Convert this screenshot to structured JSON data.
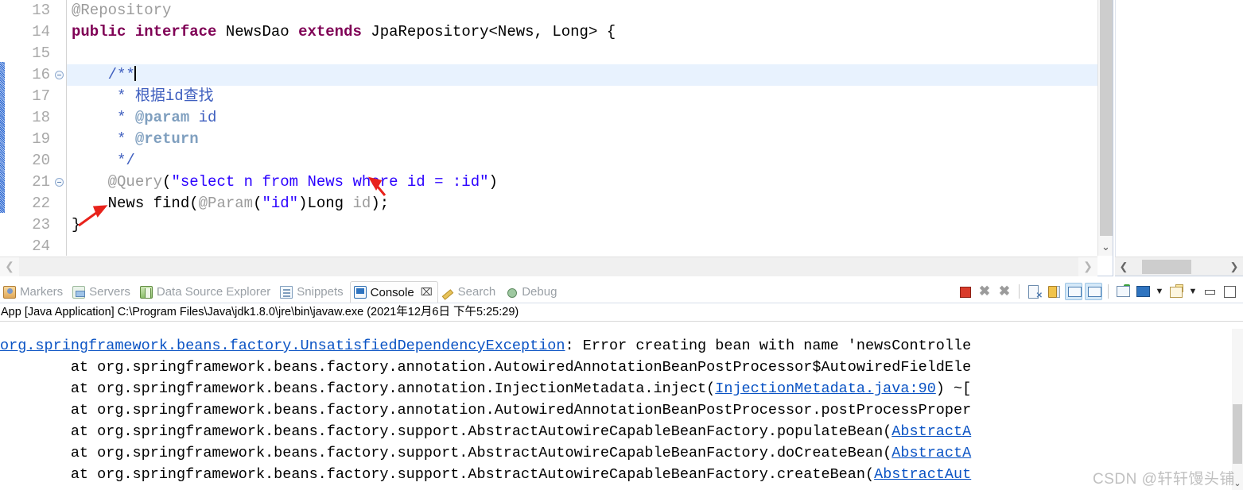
{
  "editor": {
    "lines": [
      {
        "num": "13",
        "fold": false,
        "highlight": false,
        "tokens": [
          {
            "t": "ann",
            "v": "@Repository"
          }
        ]
      },
      {
        "num": "14",
        "fold": false,
        "highlight": false,
        "tokens": [
          {
            "t": "kw",
            "v": "public"
          },
          {
            "t": "plain",
            "v": " "
          },
          {
            "t": "kw",
            "v": "interface"
          },
          {
            "t": "plain",
            "v": " NewsDao "
          },
          {
            "t": "kw",
            "v": "extends"
          },
          {
            "t": "plain",
            "v": " JpaRepository<News, Long> {"
          }
        ]
      },
      {
        "num": "15",
        "fold": false,
        "highlight": false,
        "tokens": []
      },
      {
        "num": "16",
        "fold": true,
        "highlight": true,
        "caret": true,
        "tokens": [
          {
            "t": "plain",
            "v": "    "
          },
          {
            "t": "cmt",
            "v": "/**"
          }
        ]
      },
      {
        "num": "17",
        "fold": false,
        "highlight": false,
        "tokens": [
          {
            "t": "plain",
            "v": "     "
          },
          {
            "t": "cmt",
            "v": "* 根据id查找"
          }
        ]
      },
      {
        "num": "18",
        "fold": false,
        "highlight": false,
        "tokens": [
          {
            "t": "plain",
            "v": "     "
          },
          {
            "t": "cmt",
            "v": "* "
          },
          {
            "t": "cmtk",
            "v": "@param"
          },
          {
            "t": "cmt",
            "v": " id"
          }
        ]
      },
      {
        "num": "19",
        "fold": false,
        "highlight": false,
        "tokens": [
          {
            "t": "plain",
            "v": "     "
          },
          {
            "t": "cmt",
            "v": "* "
          },
          {
            "t": "cmtk",
            "v": "@return"
          }
        ]
      },
      {
        "num": "20",
        "fold": false,
        "highlight": false,
        "tokens": [
          {
            "t": "plain",
            "v": "     "
          },
          {
            "t": "cmt",
            "v": "*/"
          }
        ]
      },
      {
        "num": "21",
        "fold": true,
        "highlight": false,
        "tokens": [
          {
            "t": "plain",
            "v": "    "
          },
          {
            "t": "ann",
            "v": "@Query"
          },
          {
            "t": "plain",
            "v": "("
          },
          {
            "t": "str",
            "v": "\"select n from News where id = :id\""
          },
          {
            "t": "plain",
            "v": ")"
          }
        ]
      },
      {
        "num": "22",
        "fold": false,
        "highlight": false,
        "tokens": [
          {
            "t": "plain",
            "v": "    News find("
          },
          {
            "t": "ann",
            "v": "@Param"
          },
          {
            "t": "plain",
            "v": "("
          },
          {
            "t": "str",
            "v": "\"id\""
          },
          {
            "t": "plain",
            "v": ")Long "
          },
          {
            "t": "ann",
            "v": "id"
          },
          {
            "t": "plain",
            "v": ");"
          }
        ]
      },
      {
        "num": "23",
        "fold": false,
        "highlight": false,
        "tokens": [
          {
            "t": "plain",
            "v": "}"
          }
        ]
      },
      {
        "num": "24",
        "fold": false,
        "highlight": false,
        "tokens": []
      }
    ],
    "scrollbar": {
      "down_arrow": "⌄",
      "left_arrow": "❮",
      "right_arrow": "❯"
    }
  },
  "view_tabs": [
    {
      "label": "Markers",
      "icon": "markers-icon",
      "active": false,
      "closable": false
    },
    {
      "label": "Servers",
      "icon": "servers-icon",
      "active": false,
      "closable": false
    },
    {
      "label": "Data Source Explorer",
      "icon": "data-source-explorer-icon",
      "active": false,
      "closable": false
    },
    {
      "label": "Snippets",
      "icon": "snippets-icon",
      "active": false,
      "closable": false
    },
    {
      "label": "Console",
      "icon": "console-icon",
      "active": true,
      "closable": true,
      "close_glyph": "⌧"
    },
    {
      "label": "Search",
      "icon": "search-icon",
      "active": false,
      "closable": false
    },
    {
      "label": "Debug",
      "icon": "debug-icon",
      "active": false,
      "closable": false
    }
  ],
  "console_toolbar": [
    {
      "name": "terminate-button",
      "kind": "t-stop",
      "selected": false
    },
    {
      "name": "remove-launch-button",
      "kind": "t-x",
      "glyph": "✖",
      "selected": false
    },
    {
      "name": "remove-all-terminated-button",
      "kind": "t-xx",
      "glyph": "✖",
      "selected": false
    },
    {
      "name": "separator-1",
      "kind": "sep"
    },
    {
      "name": "clear-console-button",
      "kind": "t-clear",
      "selected": false
    },
    {
      "name": "scroll-lock-button",
      "kind": "t-lock",
      "selected": false
    },
    {
      "name": "show-console-on-output-button",
      "kind": "t-mon",
      "selected": true
    },
    {
      "name": "show-console-on-error-button",
      "kind": "t-monr",
      "selected": true
    },
    {
      "name": "separator-2",
      "kind": "sep"
    },
    {
      "name": "pin-console-button",
      "kind": "t-pin",
      "selected": false
    },
    {
      "name": "display-selected-console-button",
      "kind": "t-disp",
      "selected": false
    },
    {
      "name": "display-console-dropdown",
      "kind": "t-caret",
      "glyph": "▼"
    },
    {
      "name": "open-console-button",
      "kind": "t-new",
      "selected": false
    },
    {
      "name": "open-console-dropdown",
      "kind": "t-caret",
      "glyph": "▼"
    },
    {
      "name": "minimize-view-button",
      "kind": "t-min"
    },
    {
      "name": "maximize-view-button",
      "kind": "t-max"
    }
  ],
  "console": {
    "header": "App [Java Application] C:\\Program Files\\Java\\jdk1.8.0\\jre\\bin\\javaw.exe (2021年12月6日 下午5:25:29)",
    "lines": [
      {
        "segments": [
          {
            "t": "lnk",
            "v": "org.springframework.beans.factory.UnsatisfiedDependencyException"
          },
          {
            "t": "txt",
            "v": ": Error creating bean with name 'newsControlle"
          }
        ]
      },
      {
        "segments": [
          {
            "t": "txt",
            "v": "        at org.springframework.beans.factory.annotation.AutowiredAnnotationBeanPostProcessor$AutowiredFieldEle"
          }
        ]
      },
      {
        "segments": [
          {
            "t": "txt",
            "v": "        at org.springframework.beans.factory.annotation.InjectionMetadata.inject("
          },
          {
            "t": "lnk",
            "v": "InjectionMetadata.java:90"
          },
          {
            "t": "txt",
            "v": ") ~["
          }
        ]
      },
      {
        "segments": [
          {
            "t": "txt",
            "v": "        at org.springframework.beans.factory.annotation.AutowiredAnnotationBeanPostProcessor.postProcessProper"
          }
        ]
      },
      {
        "segments": [
          {
            "t": "txt",
            "v": "        at org.springframework.beans.factory.support.AbstractAutowireCapableBeanFactory.populateBean("
          },
          {
            "t": "lnk",
            "v": "AbstractA"
          }
        ]
      },
      {
        "segments": [
          {
            "t": "txt",
            "v": "        at org.springframework.beans.factory.support.AbstractAutowireCapableBeanFactory.doCreateBean("
          },
          {
            "t": "lnk",
            "v": "AbstractA"
          }
        ]
      },
      {
        "segments": [
          {
            "t": "txt",
            "v": "        at org.springframework.beans.factory.support.AbstractAutowireCapableBeanFactory.createBean("
          },
          {
            "t": "lnk",
            "v": "AbstractAut"
          }
        ]
      }
    ],
    "scroll_down_glyph": "⌄"
  },
  "watermark": "CSDN @轩轩馒头铺",
  "colors": {
    "keyword": "#7f0055",
    "string": "#2a00ff",
    "comment": "#3f5fbf",
    "comment_tag": "#7f9fbf",
    "annotation": "#9b9b9b",
    "link": "#0a53c4",
    "highlight_line": "#e8f2fe"
  }
}
